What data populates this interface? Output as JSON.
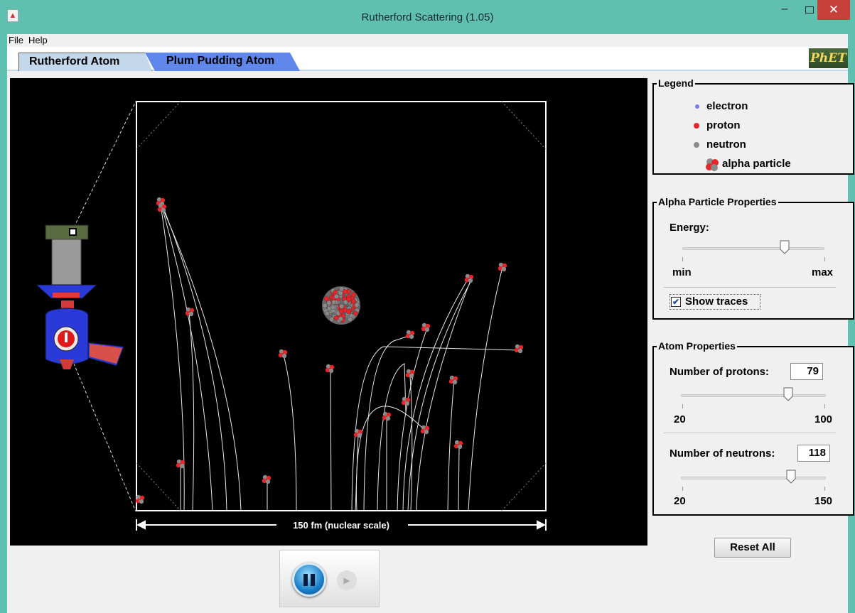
{
  "window": {
    "title": "Rutherford Scattering (1.05)",
    "app_icon_glyph": "▲",
    "min_glyph": "–",
    "close_glyph": "✕"
  },
  "menu": {
    "items": [
      "File",
      "Help"
    ]
  },
  "tabs": [
    {
      "label": "Rutherford Atom",
      "active": true
    },
    {
      "label": "Plum Pudding Atom",
      "active": false
    }
  ],
  "logo": {
    "text": "PhET"
  },
  "canvas": {
    "scale_label": "150 fm (nuclear scale)"
  },
  "legend": {
    "title": "Legend",
    "items": [
      {
        "label": "electron",
        "color": "#7b7bef"
      },
      {
        "label": "proton",
        "color": "#e8252a"
      },
      {
        "label": "neutron",
        "color": "#8a8a8a"
      },
      {
        "label": "alpha particle",
        "color": "#c44a4a"
      }
    ]
  },
  "alpha_properties": {
    "title": "Alpha Particle Properties",
    "energy_label": "Energy:",
    "min_label": "min",
    "max_label": "max",
    "energy_level": 0.72,
    "show_traces_label": "Show traces",
    "show_traces_checked": true,
    "check_glyph": "✔"
  },
  "atom_properties": {
    "title": "Atom Properties",
    "protons_label": "Number of protons:",
    "protons_value": "79",
    "protons_min": "20",
    "protons_max": "100",
    "neutrons_label": "Number of neutrons:",
    "neutrons_value": "118",
    "neutrons_min": "20",
    "neutrons_max": "150"
  },
  "reset_label": "Reset All",
  "clock": {
    "step_glyph": "▶"
  },
  "colors": {
    "proton": "#e8252a",
    "neutron": "#8a8a8a",
    "panel_border": "#000000",
    "tab_active": "#c4d8ec",
    "tab_inactive": "#5f87ec"
  }
}
